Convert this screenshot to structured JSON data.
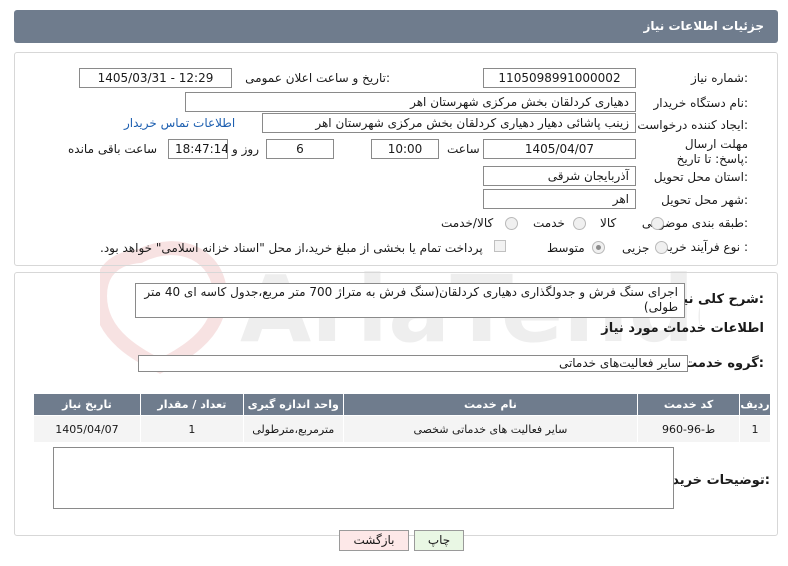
{
  "header": {
    "title": "جزئیات اطلاعات نیاز"
  },
  "labels": {
    "need_number": "شماره نیاز:",
    "announce_datetime": "تاریخ و ساعت اعلان عمومی:",
    "buyer_org": "نام دستگاه خریدار:",
    "requester": "ایجاد کننده درخواست:",
    "contact_link": "اطلاعات تماس خریدار",
    "deadline": "مهلت ارسال پاسخ: تا تاریخ:",
    "time_label": "ساعت",
    "days_label": "روز و",
    "remaining_label": "ساعت باقی مانده",
    "province": "استان محل تحویل:",
    "city": "شهر محل تحویل:",
    "category": "طبقه بندی موضوعی:",
    "process_type": "نوع فرآیند خرید :",
    "general_description": "شرح کلی نیاز:",
    "services_info": "اطلاعات خدمات مورد نیاز",
    "service_group": "گروه خدمت:",
    "buyer_notes": "توضیحات خریدار:"
  },
  "fields": {
    "need_number": "1105098991000002",
    "announce_datetime": "1405/03/31 - 12:29",
    "buyer_org": "دهیاری کردلقان بخش مرکزی شهرستان اهر",
    "requester": "زینب پاشائی دهیار دهیاری کردلقان بخش مرکزی شهرستان اهر",
    "deadline_date": "1405/04/07",
    "deadline_time": "10:00",
    "remaining_days": "6",
    "remaining_time": "18:47:14",
    "province": "آذربایجان شرقی",
    "city": "اهر",
    "general_description": "اجرای سنگ فرش و جدولگذاری دهیاری کردلقان(سنگ فرش به متراژ 700 متر مربع،جدول کاسه ای 40 متر طولی)",
    "service_group": "سایر فعالیت‌های خدماتی",
    "buyer_notes": ""
  },
  "category_options": [
    {
      "label": "کالا",
      "checked": false
    },
    {
      "label": "خدمت",
      "checked": false
    },
    {
      "label": "کالا/خدمت",
      "checked": false
    }
  ],
  "process_options": [
    {
      "label": "جزیی",
      "checked": false
    },
    {
      "label": "متوسط",
      "checked": true
    }
  ],
  "payment_note": "پرداخت تمام یا بخشی از مبلغ خرید،از محل \"اسناد خزانه اسلامی\" خواهد بود.",
  "table": {
    "headers": [
      "ردیف",
      "کد خدمت",
      "نام خدمت",
      "واحد اندازه گیری",
      "تعداد / مقدار",
      "تاریخ نیاز"
    ],
    "rows": [
      [
        "1",
        "ط-96-960",
        "سایر فعالیت های خدماتی شخصی",
        "مترمربع،مترطولی",
        "1",
        "1405/04/07"
      ]
    ]
  },
  "buttons": {
    "print": "چاپ",
    "back": "بازگشت"
  },
  "watermark_text": "AriaTender.net",
  "colors": {
    "header": "#6f7c8d",
    "link": "#1d5fb0",
    "back_button": "#fde8e8",
    "print_button": "#e9f7e4"
  }
}
